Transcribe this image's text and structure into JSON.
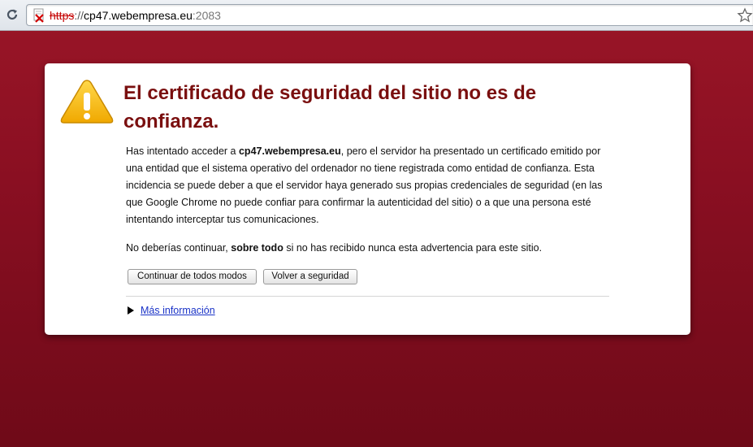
{
  "browser": {
    "url_scheme": "https",
    "url_separator": "://",
    "url_host": "cp47.webempresa.eu",
    "url_port": ":2083",
    "reload_icon": "reload-icon",
    "lock_icon": "broken-lock-icon",
    "star_icon": "star-icon"
  },
  "interstitial": {
    "warning_icon": "warning-icon",
    "title": "El certificado de seguridad del sitio no es de confianza.",
    "paragraph1": {
      "before_host": "Has intentado acceder a ",
      "host": "cp47.webempresa.eu",
      "after_host": ", pero el servidor ha presentado un certificado emitido por una entidad que el sistema operativo del ordenador no tiene registrada como entidad de confianza. Esta incidencia se puede deber a que el servidor haya generado sus propias credenciales de seguridad (en las que Google Chrome no puede confiar para confirmar la autenticidad del sitio) o a que una persona esté intentando interceptar tus comunicaciones."
    },
    "paragraph2": {
      "before_bold": "No deberías continuar, ",
      "bold": "sobre todo",
      "after_bold": " si no has recibido nunca esta advertencia para este sitio."
    },
    "proceed_button": "Continuar de todos modos",
    "back_button": "Volver a seguridad",
    "more_info_link": "Más información"
  },
  "colors": {
    "background": "#8a0f22",
    "title": "#7a0f0f",
    "link": "#1a33c7",
    "warning": "#f5b400"
  }
}
